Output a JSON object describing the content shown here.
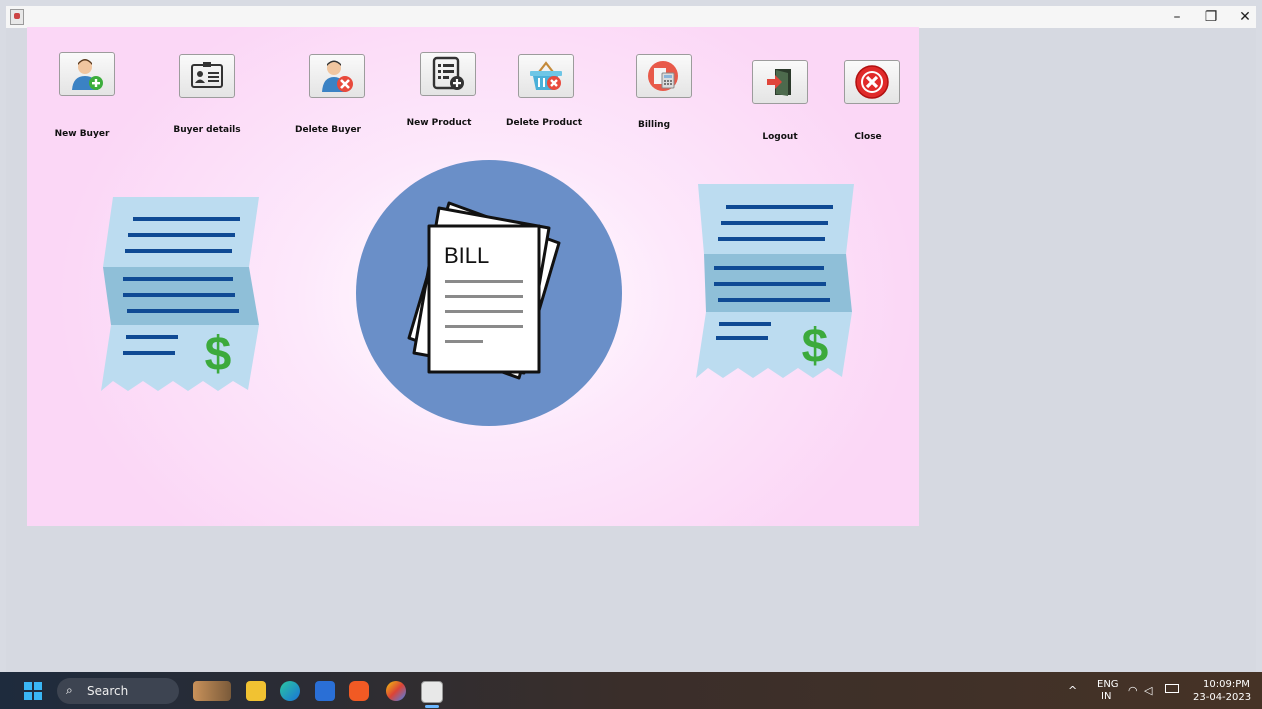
{
  "window": {
    "controls": {
      "minimize": "–",
      "maximize": "❐",
      "close": "✕"
    }
  },
  "toolbar": {
    "new_buyer": "New Buyer",
    "buyer_details": "Buyer details",
    "delete_buyer": "Delete Buyer",
    "new_product": "New Product",
    "delete_product": "Delete Product",
    "billing": "Billing",
    "logout": "Logout",
    "close": "Close"
  },
  "illustration": {
    "bill_text": "BILL",
    "dollar_symbol": "$"
  },
  "taskbar": {
    "search_label": "Search",
    "language": "ENG",
    "region": "IN",
    "time": "10:09:PM",
    "date": "23-04-2023"
  },
  "colors": {
    "panel_pink": "#fbd7f6",
    "circle_blue": "#6a8fc8",
    "receipt_light": "#bcdcf0",
    "receipt_dark": "#8fbfd8",
    "receipt_line": "#0f4a94",
    "dollar_green": "#3caa3c"
  }
}
